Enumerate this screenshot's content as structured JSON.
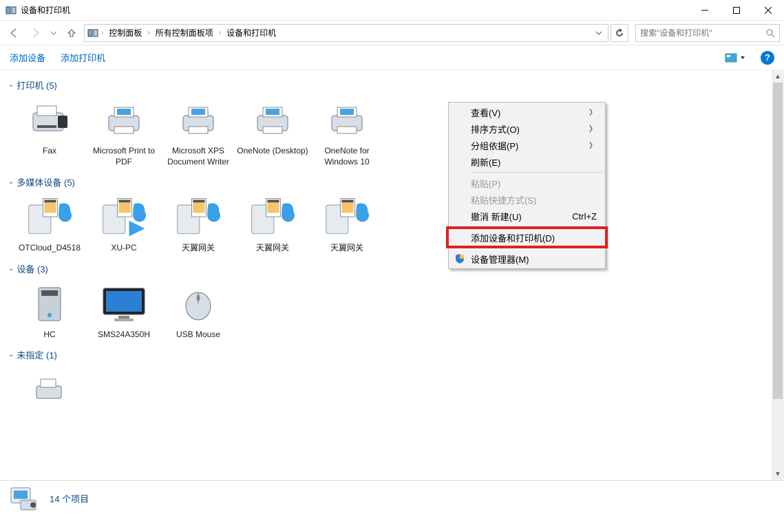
{
  "window": {
    "title": "设备和打印机"
  },
  "nav": {
    "breadcrumb": [
      "控制面板",
      "所有控制面板项",
      "设备和打印机"
    ],
    "search_placeholder": "搜索\"设备和打印机\""
  },
  "commands": {
    "add_device": "添加设备",
    "add_printer": "添加打印机"
  },
  "sections": [
    {
      "title": "打印机 (5)",
      "items": [
        {
          "label": "Fax",
          "icon": "fax"
        },
        {
          "label": "Microsoft Print to PDF",
          "icon": "printer"
        },
        {
          "label": "Microsoft XPS Document Writer",
          "icon": "printer"
        },
        {
          "label": "OneNote (Desktop)",
          "icon": "printer"
        },
        {
          "label": "OneNote for Windows 10",
          "icon": "printer"
        }
      ]
    },
    {
      "title": "多媒体设备 (5)",
      "items": [
        {
          "label": "OTCloud_D4518",
          "icon": "media"
        },
        {
          "label": "XU-PC",
          "icon": "media-play"
        },
        {
          "label": "天翼网关",
          "icon": "media"
        },
        {
          "label": "天翼网关",
          "icon": "media"
        },
        {
          "label": "天翼网关",
          "icon": "media"
        }
      ]
    },
    {
      "title": "设备 (3)",
      "items": [
        {
          "label": "HC",
          "icon": "pc"
        },
        {
          "label": "SMS24A350H",
          "icon": "monitor"
        },
        {
          "label": "USB Mouse",
          "icon": "mouse"
        }
      ]
    },
    {
      "title": "未指定 (1)",
      "items": [
        {
          "label": "",
          "icon": "printer-small"
        }
      ]
    }
  ],
  "status": {
    "text": "14 个项目"
  },
  "context_menu": {
    "items": [
      {
        "label": "查看(V)",
        "submenu": true
      },
      {
        "label": "排序方式(O)",
        "submenu": true
      },
      {
        "label": "分组依据(P)",
        "submenu": true
      },
      {
        "label": "刷新(E)"
      },
      {
        "sep": true
      },
      {
        "label": "粘贴(P)",
        "disabled": true
      },
      {
        "label": "粘贴快捷方式(S)",
        "disabled": true
      },
      {
        "label": "撤消 新建(U)",
        "shortcut": "Ctrl+Z"
      },
      {
        "sep": true
      },
      {
        "label": "添加设备和打印机(D)",
        "highlight": true
      },
      {
        "sep": true
      },
      {
        "label": "设备管理器(M)",
        "shield": true
      }
    ]
  }
}
